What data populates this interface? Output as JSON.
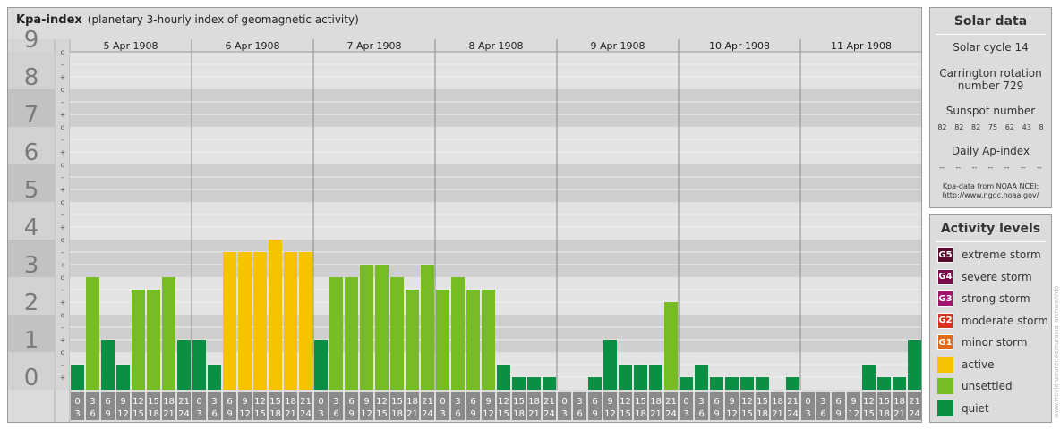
{
  "header": {
    "title": "Kpa-index",
    "subtitle": "(planetary 3-hourly index of geomagnetic activity)"
  },
  "chart_data": {
    "type": "bar",
    "title": "Kpa-index",
    "subtitle": "(planetary 3-hourly index of geomagnetic activity)",
    "ylim": [
      0,
      9
    ],
    "y_ticks": [
      "0",
      "1",
      "2",
      "3",
      "4",
      "5",
      "6",
      "7",
      "8",
      "9"
    ],
    "sub_ticks": [
      "+",
      "–",
      "o"
    ],
    "days": [
      "5 Apr 1908",
      "6 Apr 1908",
      "7 Apr 1908",
      "8 Apr 1908",
      "9 Apr 1908",
      "10 Apr 1908",
      "11 Apr 1908"
    ],
    "interval_labels": [
      [
        "0",
        "3"
      ],
      [
        "3",
        "6"
      ],
      [
        "6",
        "9"
      ],
      [
        "9",
        "12"
      ],
      [
        "12",
        "15"
      ],
      [
        "15",
        "18"
      ],
      [
        "18",
        "21"
      ],
      [
        "21",
        "24"
      ]
    ],
    "values": [
      [
        0.667,
        3.0,
        1.333,
        0.667,
        2.667,
        2.667,
        3.0,
        1.333
      ],
      [
        1.333,
        0.667,
        3.667,
        3.667,
        3.667,
        4.0,
        3.667,
        3.667
      ],
      [
        1.333,
        3.0,
        3.0,
        3.333,
        3.333,
        3.0,
        2.667,
        3.333
      ],
      [
        2.667,
        3.0,
        2.667,
        2.667,
        0.667,
        0.333,
        0.333,
        0.333
      ],
      [
        0.0,
        0.0,
        0.333,
        1.333,
        0.667,
        0.667,
        0.667,
        2.333
      ],
      [
        0.333,
        0.667,
        0.333,
        0.333,
        0.333,
        0.333,
        0.0,
        0.333
      ],
      [
        0.0,
        0.0,
        0.0,
        0.0,
        0.667,
        0.333,
        0.333,
        1.333
      ]
    ],
    "grid": true,
    "colors": {
      "quiet": "#0a8f45",
      "unsettled": "#77bc24",
      "active": "#f7c200"
    }
  },
  "solar": {
    "title": "Solar data",
    "cycle": "Solar cycle 14",
    "carrington_line1": "Carrington rotation",
    "carrington_line2": "number 729",
    "sunspot_label": "Sunspot number",
    "sunspots": [
      "82",
      "82",
      "82",
      "75",
      "62",
      "43",
      "8"
    ],
    "ap_label": "Daily Ap-index",
    "ap_values": [
      "--",
      "--",
      "--",
      "--",
      "--",
      "--",
      "--"
    ],
    "source_line1": "Kpa-data from NOAA NCEI:",
    "source_line2": "http://www.ngdc.noaa.gov/"
  },
  "levels": {
    "title": "Activity levels",
    "items": [
      {
        "code": "G5",
        "label": "extreme storm",
        "color": "#5a0a2a"
      },
      {
        "code": "G4",
        "label": "severe storm",
        "color": "#7a0a4a"
      },
      {
        "code": "G3",
        "label": "strong storm",
        "color": "#a0136e"
      },
      {
        "code": "G2",
        "label": "moderate storm",
        "color": "#d6341d"
      },
      {
        "code": "G1",
        "label": "minor storm",
        "color": "#e06a1a"
      },
      {
        "code": "",
        "label": "active",
        "color": "#f7c200"
      },
      {
        "code": "",
        "label": "unsettled",
        "color": "#77bc24"
      },
      {
        "code": "",
        "label": "quiet",
        "color": "#0a8f45"
      }
    ]
  },
  "credit": "www.frevlenzeufer.de/eurasia_archive/info"
}
